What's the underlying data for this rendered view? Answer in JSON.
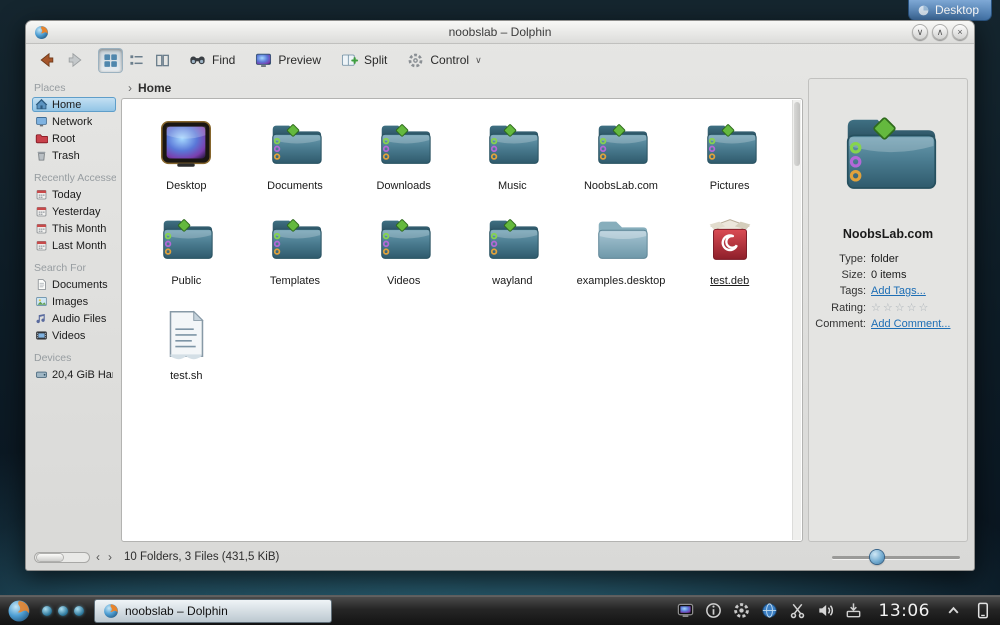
{
  "glyphs": {
    "minimize": "∨",
    "maximize": "∧",
    "close": "×",
    "caret_down": "∨",
    "crumb": "›",
    "left": "‹",
    "right": "›"
  },
  "desktop": {
    "toolbox_label": "Desktop"
  },
  "window": {
    "title": "noobslab – Dolphin",
    "toolbar": {
      "find": "Find",
      "preview": "Preview",
      "split": "Split",
      "control": "Control"
    },
    "breadcrumb": "Home"
  },
  "places": {
    "sections": [
      {
        "title": "Places",
        "items": [
          {
            "label": "Home",
            "icon": "si-home",
            "cls": "selected",
            "name": "sidebar-item-home"
          },
          {
            "label": "Network",
            "icon": "si-network",
            "name": "sidebar-item-network"
          },
          {
            "label": "Root",
            "icon": "si-root",
            "name": "sidebar-item-root"
          },
          {
            "label": "Trash",
            "icon": "si-trash",
            "name": "sidebar-item-trash"
          }
        ]
      },
      {
        "title": "Recently Accessed",
        "items": [
          {
            "label": "Today",
            "icon": "si-clock",
            "name": "sidebar-item-today"
          },
          {
            "label": "Yesterday",
            "icon": "si-clock",
            "name": "sidebar-item-yesterday"
          },
          {
            "label": "This Month",
            "icon": "si-clock",
            "name": "sidebar-item-this-month"
          },
          {
            "label": "Last Month",
            "icon": "si-clock",
            "name": "sidebar-item-last-month"
          }
        ]
      },
      {
        "title": "Search For",
        "items": [
          {
            "label": "Documents",
            "icon": "si-doc",
            "name": "sidebar-item-documents"
          },
          {
            "label": "Images",
            "icon": "si-img",
            "name": "sidebar-item-images"
          },
          {
            "label": "Audio Files",
            "icon": "si-audio",
            "name": "sidebar-item-audio-files"
          },
          {
            "label": "Videos",
            "icon": "si-video",
            "name": "sidebar-item-videos"
          }
        ]
      },
      {
        "title": "Devices",
        "items": [
          {
            "label": "20,4 GiB Har",
            "icon": "si-drive",
            "name": "sidebar-item-hard-drive"
          }
        ]
      }
    ]
  },
  "files": [
    {
      "label": "Desktop",
      "icon": "icon-desktop",
      "name": "file-desktop"
    },
    {
      "label": "Documents",
      "icon": "icon-folder",
      "name": "file-documents"
    },
    {
      "label": "Downloads",
      "icon": "icon-folder",
      "name": "file-downloads"
    },
    {
      "label": "Music",
      "icon": "icon-folder",
      "name": "file-music"
    },
    {
      "label": "NoobsLab.com",
      "icon": "icon-folder",
      "name": "file-noobslab-com"
    },
    {
      "label": "Pictures",
      "icon": "icon-folder",
      "name": "file-pictures"
    },
    {
      "label": "Public",
      "icon": "icon-folder",
      "name": "file-public"
    },
    {
      "label": "Templates",
      "icon": "icon-folder",
      "name": "file-templates"
    },
    {
      "label": "Videos",
      "icon": "icon-folder",
      "name": "file-videos"
    },
    {
      "label": "wayland",
      "icon": "icon-folder",
      "name": "file-wayland"
    },
    {
      "label": "examples.desktop",
      "icon": "icon-folder-plain",
      "name": "file-examples-desktop"
    },
    {
      "label": "test.deb",
      "icon": "icon-deb",
      "cls": "underlined",
      "name": "file-test-deb"
    },
    {
      "label": "test.sh",
      "icon": "icon-script",
      "name": "file-test-sh"
    }
  ],
  "info": {
    "title": "NoobsLab.com",
    "fields": [
      {
        "key": "Type:",
        "value": "folder"
      },
      {
        "key": "Size:",
        "value": "0 items"
      },
      {
        "key": "Tags:",
        "value": "Add Tags...",
        "cls": "link",
        "name": "add-tags-link",
        "interactable": true
      },
      {
        "key": "Rating:",
        "value": "☆☆☆☆☆",
        "cls": "stars",
        "name": "rating-stars",
        "interactable": true
      },
      {
        "key": "Comment:",
        "value": "Add Comment...",
        "cls": "link",
        "name": "add-comment-link",
        "interactable": true
      }
    ]
  },
  "statusbar": {
    "text": "10 Folders, 3 Files (431,5 KiB)"
  },
  "taskbar": {
    "task_label": "noobslab – Dolphin",
    "clock": "13:06",
    "tray": [
      {
        "icon": "ti-screen",
        "name": "desktop-preview-tray-icon"
      },
      {
        "icon": "ti-info",
        "name": "notifications-tray-icon"
      },
      {
        "icon": "ti-gear",
        "name": "settings-tray-icon"
      },
      {
        "icon": "ti-globe",
        "name": "network-tray-icon"
      },
      {
        "icon": "ti-scissors",
        "name": "klipper-tray-icon"
      },
      {
        "icon": "ti-volume",
        "name": "volume-tray-icon"
      },
      {
        "icon": "ti-notifier",
        "name": "device-notifier-tray-icon"
      }
    ]
  }
}
